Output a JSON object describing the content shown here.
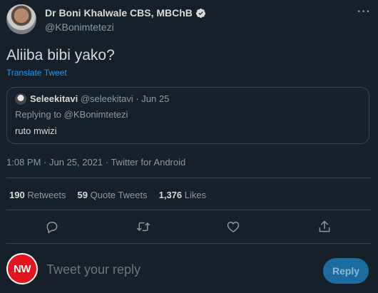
{
  "author": {
    "display_name": "Dr Boni Khalwale CBS, MBChB",
    "handle": "@KBonimtetezi",
    "more_label": "···"
  },
  "tweet": {
    "text": "Aliiba bibi yako?",
    "translate_label": "Translate Tweet"
  },
  "quote": {
    "name": "Seleekitavi",
    "meta": "@seleekitavi · Jun 25",
    "replying_to": "Replying to @KBonimtetezi",
    "text": "ruto mwizi"
  },
  "timestamp": "1:08 PM · Jun 25, 2021 · Twitter for Android",
  "stats": {
    "retweets_count": "190",
    "retweets_label": "Retweets",
    "quotes_count": "59",
    "quotes_label": "Quote Tweets",
    "likes_count": "1,376",
    "likes_label": "Likes"
  },
  "actions": {
    "icons": [
      "reply-icon",
      "retweet-icon",
      "like-icon",
      "share-icon"
    ],
    "icon_color": "#8b98a5"
  },
  "reply_box": {
    "avatar_text": "NW",
    "placeholder": "Tweet your reply",
    "button_label": "Reply"
  },
  "colors": {
    "background": "#15202b",
    "accent": "#1d9bf0",
    "border": "#38444d"
  }
}
